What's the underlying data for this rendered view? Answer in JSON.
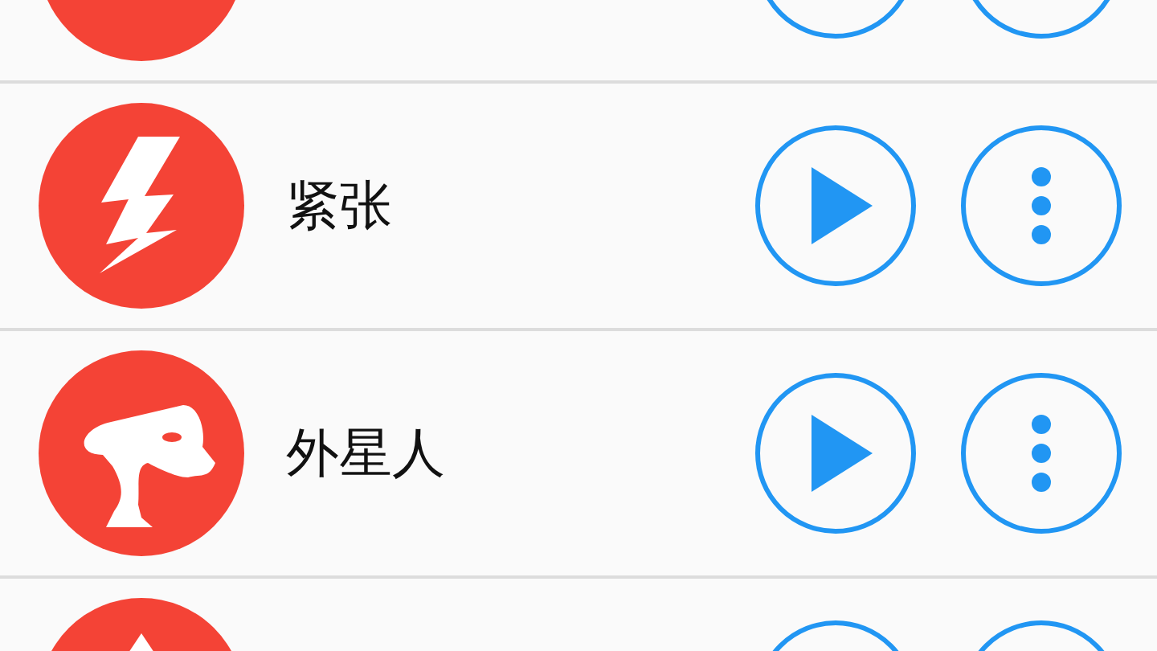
{
  "rows": [
    {
      "label": null
    },
    {
      "label": "紧张"
    },
    {
      "label": "外星人"
    },
    {
      "label": null
    }
  ]
}
